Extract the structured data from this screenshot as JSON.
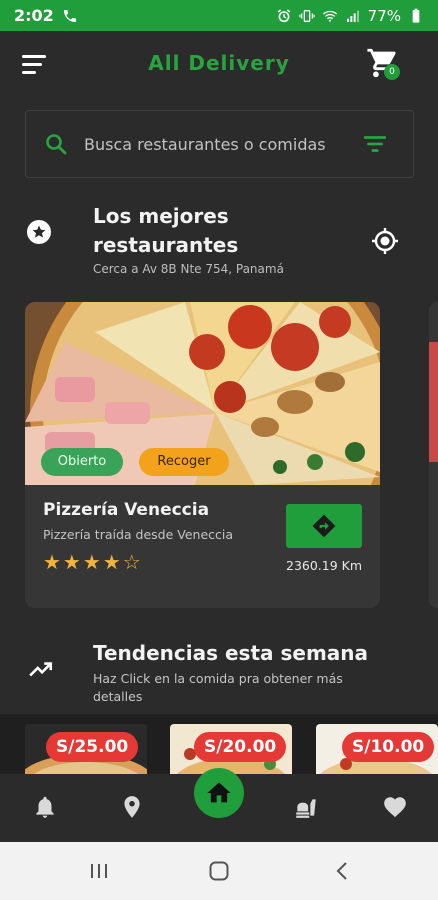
{
  "status_bar": {
    "time": "2:02",
    "battery": "77%",
    "icons": [
      "phone-icon",
      "alarm-icon",
      "vibrate-icon",
      "wifi-icon",
      "signal-icon",
      "battery-icon"
    ],
    "background": "#1f9e3b"
  },
  "app_bar": {
    "title": "All Delivery",
    "menu_icon": "menu-icon",
    "cart_icon": "cart-icon",
    "cart_count": "0"
  },
  "search": {
    "placeholder": "Busca restaurantes o comidas",
    "value": "",
    "icon": "search-icon",
    "filter_icon": "filter-icon"
  },
  "best_restaurants": {
    "title": "Los mejores restaurantes",
    "subtitle": "Cerca a Av 8B Nte 754, Panamá",
    "icon": "star-circle-icon",
    "location_icon": "gps-icon"
  },
  "restaurant_card": {
    "name": "Pizzería Veneccia",
    "description": "Pizzería traída desde Veneccia",
    "status_label": "Obierto",
    "service_label": "Recoger",
    "rating": 4,
    "rating_max": 5,
    "stars": "★★★★☆",
    "distance": "2360.19 Km",
    "directions_icon": "directions-icon"
  },
  "trends": {
    "title": "Tendencias esta semana",
    "subtitle": "Haz Click en la comida pra obtener más detalles",
    "icon": "trending-up-icon",
    "items": [
      {
        "price": "S/25.00"
      },
      {
        "price": "S/20.00"
      },
      {
        "price": "S/10.00"
      }
    ]
  },
  "bottom_nav": {
    "items": [
      "notifications-icon",
      "location-pin-icon",
      "home-icon",
      "fast-food-icon",
      "favorite-icon"
    ],
    "active": "home-icon"
  },
  "system_nav": {
    "items": [
      "recent-apps-icon",
      "home-circle-icon",
      "back-icon"
    ]
  },
  "colors": {
    "accent": "#1f9e3b",
    "title_green": "#29a33f",
    "background": "#2b2b2b",
    "card": "#363636",
    "open_pill": "#3aa35a",
    "pickup_pill": "#f3a21b",
    "price_badge": "#e53935",
    "star": "#f3b43a"
  }
}
